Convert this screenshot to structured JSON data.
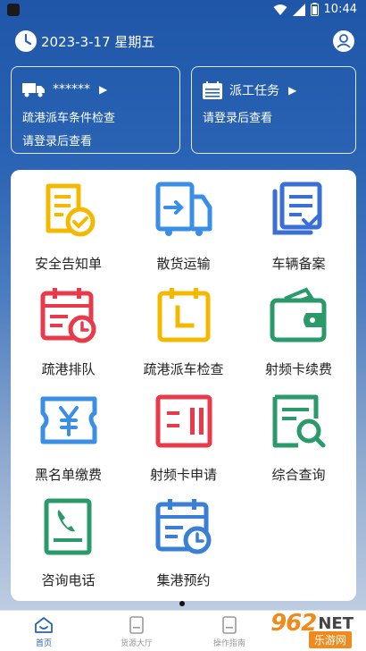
{
  "status_bar": {
    "time": "10:44"
  },
  "header": {
    "date": "2023-3-17 星期五"
  },
  "cards": {
    "left": {
      "title": "******",
      "line1": "疏港派车条件检查",
      "line2": "请登录后查看"
    },
    "right": {
      "title": "派工任务",
      "line1": "请登录后查看"
    }
  },
  "grid": {
    "items": [
      {
        "label": "安全告知单",
        "icon": "safety-notice-icon",
        "color": "#f5b800"
      },
      {
        "label": "散货运输",
        "icon": "bulk-transport-icon",
        "color": "#3a8ee6"
      },
      {
        "label": "车辆备案",
        "icon": "vehicle-record-icon",
        "color": "#3a6fd6"
      },
      {
        "label": "疏港排队",
        "icon": "queue-calendar-icon",
        "color": "#e83a4a"
      },
      {
        "label": "疏港派车检查",
        "icon": "dispatch-check-icon",
        "color": "#f5b800"
      },
      {
        "label": "射频卡续费",
        "icon": "wallet-icon",
        "color": "#2a9a6a"
      },
      {
        "label": "黑名单缴费",
        "icon": "yuan-ticket-icon",
        "color": "#3a8ee6"
      },
      {
        "label": "射频卡申请",
        "icon": "card-apply-icon",
        "color": "#e83a4a"
      },
      {
        "label": "综合查询",
        "icon": "search-doc-icon",
        "color": "#2a9a6a"
      },
      {
        "label": "咨询电话",
        "icon": "phone-doc-icon",
        "color": "#2a9a6a"
      },
      {
        "label": "集港预约",
        "icon": "appointment-calendar-icon",
        "color": "#3a7fd6"
      }
    ]
  },
  "tabbar": {
    "tabs": [
      {
        "label": "首页"
      },
      {
        "label": "货源大厅"
      },
      {
        "label": "操作指南"
      }
    ]
  },
  "watermark": {
    "number": "962",
    "net": "NET",
    "sub": "乐游网"
  }
}
